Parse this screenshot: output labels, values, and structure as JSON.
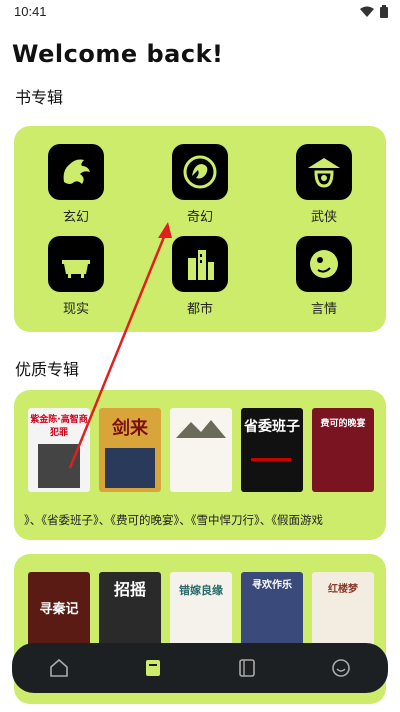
{
  "status": {
    "time": "10:41"
  },
  "header": {
    "welcome": "Welcome back!"
  },
  "sections": {
    "categories_title": "书专辑",
    "featured_title": "优质专辑"
  },
  "categories": [
    {
      "label": "玄幻",
      "icon": "dragon-icon"
    },
    {
      "label": "奇幻",
      "icon": "fantasy-dragon-icon"
    },
    {
      "label": "武侠",
      "icon": "martial-hat-icon"
    },
    {
      "label": "现实",
      "icon": "bathtub-icon"
    },
    {
      "label": "都市",
      "icon": "city-buildings-icon"
    },
    {
      "label": "言情",
      "icon": "romance-creature-icon"
    }
  ],
  "featured": [
    {
      "text": "》、《省委班子》、《费可的晚宴》、《雪中悍刀行》、《假面游戏",
      "covers": [
        "紫金陈·高智商犯罪",
        "剑来",
        "山水画",
        "省委班子",
        "费可的晚宴"
      ]
    },
    {
      "text": "",
      "covers": [
        "寻秦记",
        "招摇",
        "错嫁良缘",
        "寻欢作乐",
        "红楼梦"
      ]
    }
  ],
  "nav": {
    "items": [
      "home-icon",
      "bookshelf-icon",
      "book-icon",
      "profile-icon"
    ],
    "active_color": "#cdec6b"
  }
}
